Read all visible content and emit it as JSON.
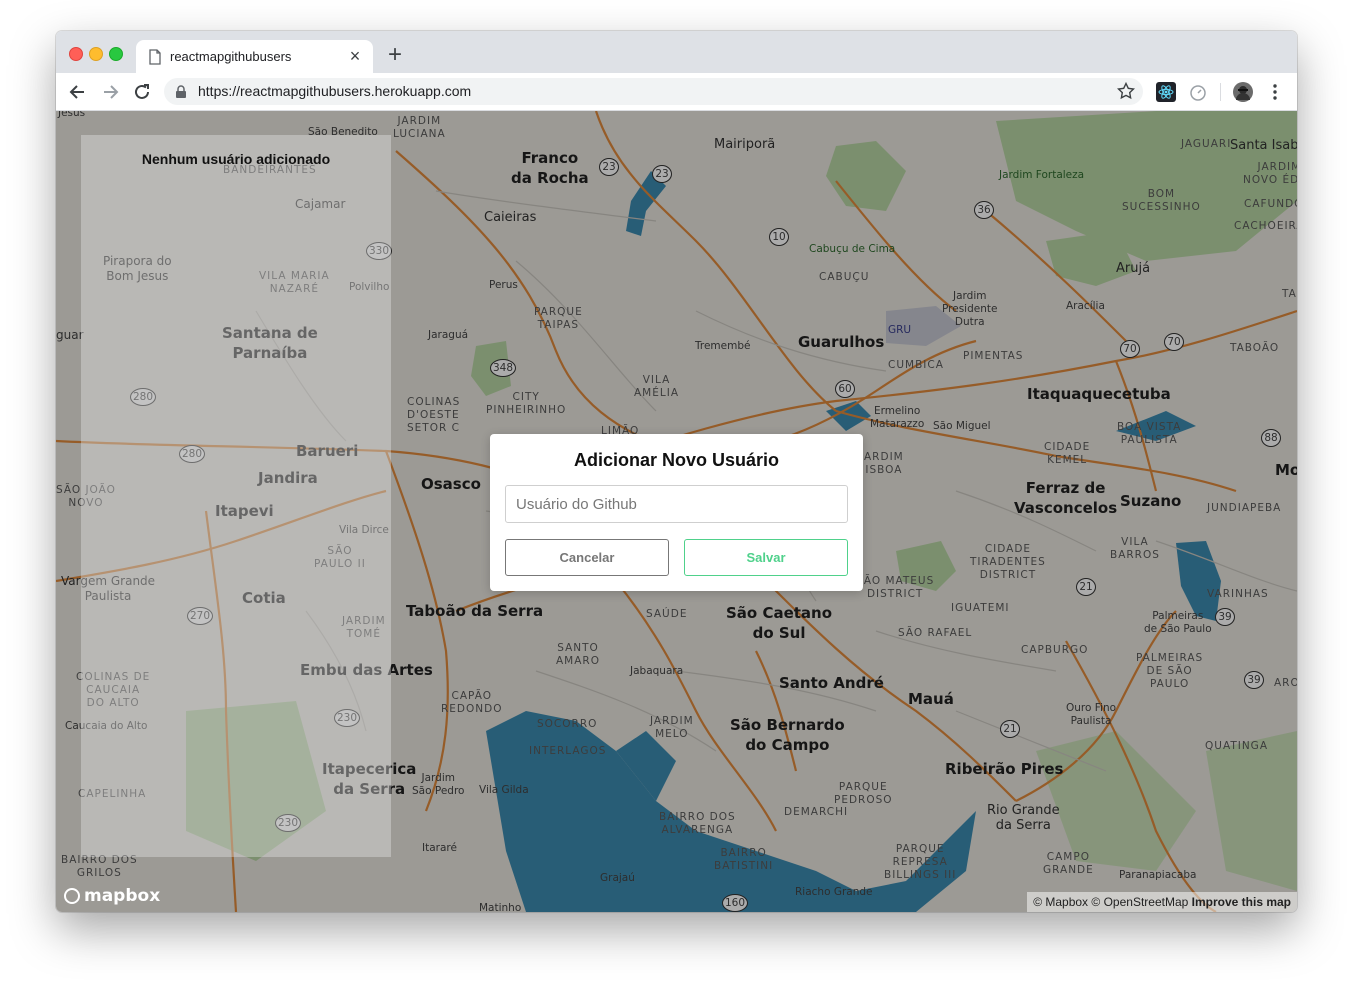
{
  "browser": {
    "tab_title": "reactmapgithubusers",
    "tab_close": "×",
    "new_tab": "+",
    "url": "https://reactmapgithubusers.herokuapp.com"
  },
  "sidebar": {
    "empty_message": "Nenhum usuário adicionado"
  },
  "modal": {
    "title": "Adicionar Novo Usuário",
    "input_placeholder": "Usuário do Github",
    "input_value": "",
    "cancel_label": "Cancelar",
    "save_label": "Salvar",
    "save_color": "#4fd18b"
  },
  "map": {
    "attribution_mapbox": "© Mapbox",
    "attribution_osm": "© OpenStreetMap",
    "improve_link": "Improve this map",
    "logo_text": "mapbox",
    "water_color": "#3d8bb1",
    "park_color": "#b8d6a4",
    "road_color": "#e08a3c",
    "labels": {
      "franco_da_rocha": "Franco\nda Rocha",
      "mairipora": "Mairiporã",
      "caieiras": "Caieiras",
      "guarulhos": "Guarulhos",
      "osasco": "Osasco",
      "barueri": "Barueri",
      "jandira": "Jandira",
      "itapevi": "Itapevi",
      "cotia": "Cotia",
      "santana_de_parnaiba": "Santana de\nParnaíba",
      "taboao_da_serra": "Taboão da Serra",
      "embu_das_artes": "Embu das Artes",
      "itapecerica": "Itapecerica\nda Serra",
      "sao_caetano": "São Caetano\ndo Sul",
      "santo_andre": "Santo André",
      "sao_bernardo": "São Bernardo\ndo Campo",
      "maua": "Mauá",
      "ribeirao_pires": "Ribeirão Pires",
      "rio_grande_da_serra": "Rio Grande\nda Serra",
      "itaquaquecetuba": "Itaquaquecetuba",
      "ferraz": "Ferraz de\nVasconcelos",
      "suzano": "Suzano",
      "aruja": "Arujá",
      "santa_isabel": "Santa Isab",
      "mogi": "Mogi",
      "perus": "Perus",
      "jaragua": "Jaraguá",
      "tremembe": "Tremembé",
      "cajamar": "Cajamar",
      "pirapora": "Pirapora do\nBom Jesus",
      "polvilho": "Polvilho",
      "jardim_fortaleza": "Jardim Fortaleza",
      "cabucu_de_cima": "Cabuçu de Cima",
      "jardim_presidente_dutra": "Jardim\nPresidente\nDutra",
      "aracilia": "Aracília",
      "ermelino": "Ermelino\nMatarazzo",
      "sao_miguel": "São Miguel",
      "jabaquara": "Jabaquara",
      "vila_dirce": "Vila Dirce",
      "jardim_sao_pedro": "Jardim\nSão Pedro",
      "vila_gilda": "Vila Gilda",
      "itarare": "Itararé",
      "grajau": "Grajaú",
      "matinho": "Matinho",
      "riacho_grande": "Riacho Grande",
      "palmeiras_sp": "Palmeiras\nde São Paulo",
      "ouro_fino": "Ouro Fino\nPaulista",
      "paranapiacaba": "Paranapiacaba",
      "vargem_grande": "Vargem Grande\nPaulista",
      "caucaia": "Caucaia do Alto",
      "guarulhos_airport": "GRU",
      "jardim_luciana": "JARDIM\nLUCIANA",
      "sao_benedito": "São Benedito",
      "bandeirantes": "BANDEIRANTES",
      "vila_maria_nazare": "VILA MARIA\nNAZARÉ",
      "parque_taipas": "PARQUE\nTAIPAS",
      "cabucu": "CABUÇU",
      "vila_amelia": "VILA\nAMÉLIA",
      "colinas_doeste": "COLINAS\nD'OESTE\nSETOR C",
      "city_pinheirinho": "CITY\nPINHEIRINHO",
      "limao": "LIMÃO",
      "cumbica": "CUMBICA",
      "pimentas": "PIMENTAS",
      "bom_sucessinho": "BOM\nSUCESSINHO",
      "jaguari": "JAGUARI",
      "jardim_novo_eden": "JARDIM\nNOVO ÉDEN",
      "cafundo": "CAFUNDÓ",
      "cachoeira": "CACHOEIRA",
      "taboao": "TABOÃO",
      "cidade_kemel": "CIDADE\nKEMEL",
      "boa_vista_paulista": "BOA VISTA\nPAULISTA",
      "jundiapeba": "JUNDIAPEBA",
      "vila_barros": "VILA\nBARROS",
      "cidade_tiradentes": "CIDADE\nTIRADENTES\nDISTRICT",
      "sao_mateus": "SÃO MATEUS\nDISTRICT",
      "iguatemi": "IGUATEMI",
      "sao_rafael": "SÃO RAFAEL",
      "capburgo": "CAPBURGO",
      "varinhas": "VARINHAS",
      "palmeiras_caps": "PALMEIRAS\nDE SÃO\nPAULO",
      "quatinga": "QUATINGA",
      "saude": "SAÚDE",
      "santo_amaro": "SANTO\nAMARO",
      "capao_redondo": "CAPÃO\nREDONDO",
      "socorro": "SOCORRO",
      "interlagos": "INTERLAGOS",
      "jardim_melo": "JARDIM\nMELO",
      "demarchi": "DEMARCHI",
      "parque_pedroso": "PARQUE\nPEDROSO",
      "bairro_alvarenga": "BAIRRO DOS\nALVARENGA",
      "bairro_batistini": "BAIRRO\nBATISTINI",
      "parque_billings": "PARQUE\nREPRESA\nBILLINGS III",
      "campo_grande": "CAMPO\nGRANDE",
      "sao_joao_novo": "SÃO JOÃO\nNOVO",
      "sao_paulo_ii": "SÃO\nPAULO II",
      "jardim_tome": "JARDIM\nTOMÉ",
      "colinas_caucaia": "COLINAS DE\nCAUCAIA\nDO ALTO",
      "capelinha": "CAPELINHA",
      "bairro_grilos": "BAIRRO DOS\nGRILOS",
      "jardim_lisboa": "ARDIM\nISBOA",
      "guarara": "guar",
      "jesus": "Jesus",
      "aro": "ARO",
      "ta": "TA"
    },
    "shields": [
      "23",
      "23",
      "10",
      "36",
      "348",
      "60",
      "70",
      "70",
      "88",
      "21",
      "39",
      "39",
      "21",
      "160",
      "280",
      "280",
      "270",
      "230",
      "230",
      "330"
    ]
  }
}
